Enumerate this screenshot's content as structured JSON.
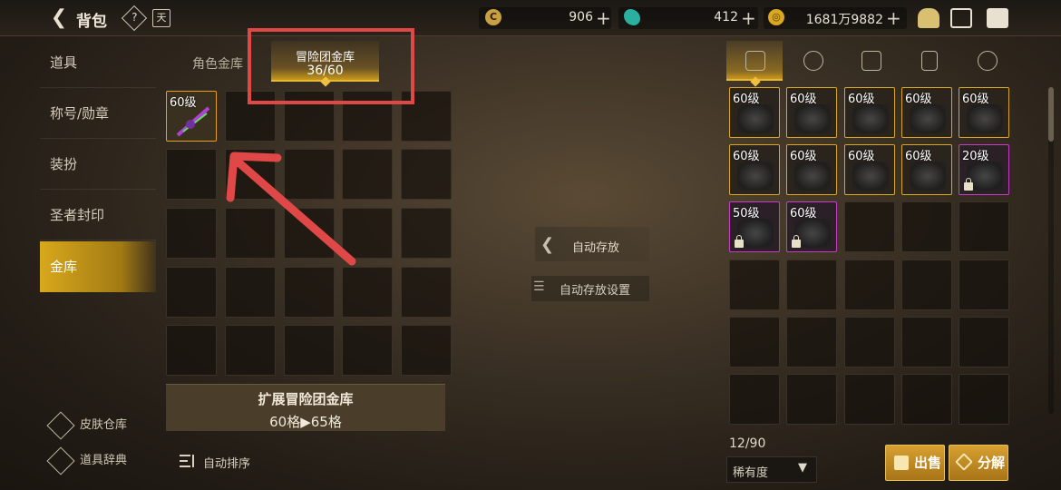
{
  "header": {
    "title": "背包",
    "help_icon": "?",
    "calendar_icon": "天"
  },
  "currency": [
    {
      "icon": "coin-icon",
      "value": "906"
    },
    {
      "icon": "gem-icon",
      "value": "412"
    },
    {
      "icon": "gold-icon",
      "value": "1681万9882"
    }
  ],
  "sidebar": {
    "items": [
      "道具",
      "称号/勋章",
      "装扮",
      "圣者封印",
      "金库"
    ],
    "active_index": 4,
    "bottom": [
      "皮肤仓库",
      "道具辞典"
    ]
  },
  "vault": {
    "tabs": [
      "角色金库",
      "冒险团金库"
    ],
    "active_tab": "冒险团金库",
    "capacity": "36/60",
    "slots": [
      {
        "level": "60级",
        "type": "weapon"
      }
    ],
    "expand_title": "扩展冒险团金库",
    "expand_detail": "60格▶65格",
    "sort_label": "自动排序"
  },
  "middle": {
    "auto_store": "自动存放",
    "auto_store_settings": "自动存放设置"
  },
  "inventory": {
    "tabs": [
      "equipment-icon",
      "potion-icon",
      "material-icon",
      "card-icon",
      "emblem-icon"
    ],
    "slots": [
      {
        "level": "60级",
        "rarity": "gold"
      },
      {
        "level": "60级",
        "rarity": "gold"
      },
      {
        "level": "60级",
        "rarity": "gold"
      },
      {
        "level": "60级",
        "rarity": "gold"
      },
      {
        "level": "60级",
        "rarity": "gold"
      },
      {
        "level": "60级",
        "rarity": "gold"
      },
      {
        "level": "60级",
        "rarity": "gold"
      },
      {
        "level": "60级",
        "rarity": "gold"
      },
      {
        "level": "60级",
        "rarity": "gold"
      },
      {
        "level": "20级",
        "rarity": "purple",
        "locked": true
      },
      {
        "level": "50级",
        "rarity": "purple",
        "locked": true
      },
      {
        "level": "60级",
        "rarity": "purple",
        "locked": true
      }
    ],
    "count": "12/90",
    "sort_select": "稀有度",
    "sell": "出售",
    "disassemble": "分解"
  },
  "colors": {
    "accent": "#e8b830",
    "annotation_red": "#e04848",
    "gold_border": "#d8a820",
    "purple_border": "#c83cc8"
  }
}
